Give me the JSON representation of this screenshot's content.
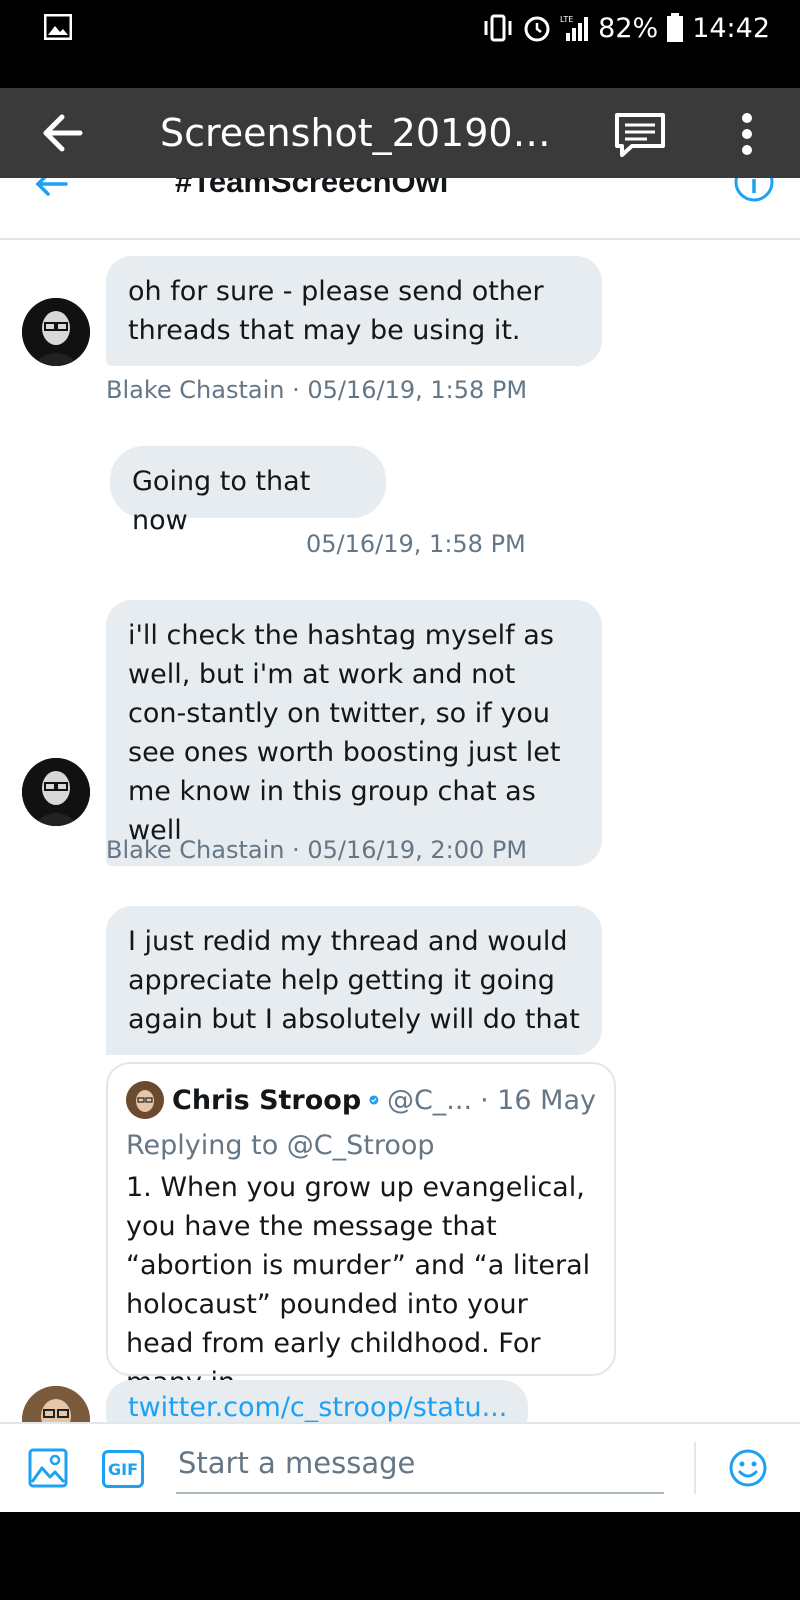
{
  "status_bar": {
    "network": "LTE",
    "battery": "82%",
    "time": "14:42"
  },
  "viewer": {
    "title": "Screenshot_2019052...",
    "icons": [
      "back-arrow-icon",
      "comment-icon",
      "more-vert-icon"
    ]
  },
  "conversation": {
    "title": "#TeamScreechOwl"
  },
  "messages": [
    {
      "text": "oh for sure - please send other threads that may be using it.",
      "meta": "Blake Chastain · 05/16/19, 1:58 PM"
    },
    {
      "text": "Going to that now",
      "meta": "05/16/19, 1:58 PM"
    },
    {
      "text": "i'll check the hashtag myself as well, but i'm at work and not con-stantly on twitter, so if you see ones worth boosting just let me know in this group chat as well",
      "meta": "Blake Chastain · 05/16/19, 2:00 PM"
    },
    {
      "text": "I just redid my thread and would appreciate help getting it going again but I absolutely will do that"
    }
  ],
  "quoted_tweet": {
    "author": "Chris Stroop",
    "handle": "@C_...",
    "date": "· 16 May",
    "reply": "Replying to @C_Stroop",
    "text": "1. When you grow up evangelical, you have the message that “abortion is murder” and “a literal holocaust” pounded into your head from early childhood. For many in..."
  },
  "link_text": "twitter.com/c_stroop/statu...",
  "composer": {
    "placeholder": "Start a message",
    "gif_label": "GIF"
  },
  "colors": {
    "accent": "#1da1f2",
    "bubble": "#e6ecf0",
    "meta": "#657786"
  }
}
